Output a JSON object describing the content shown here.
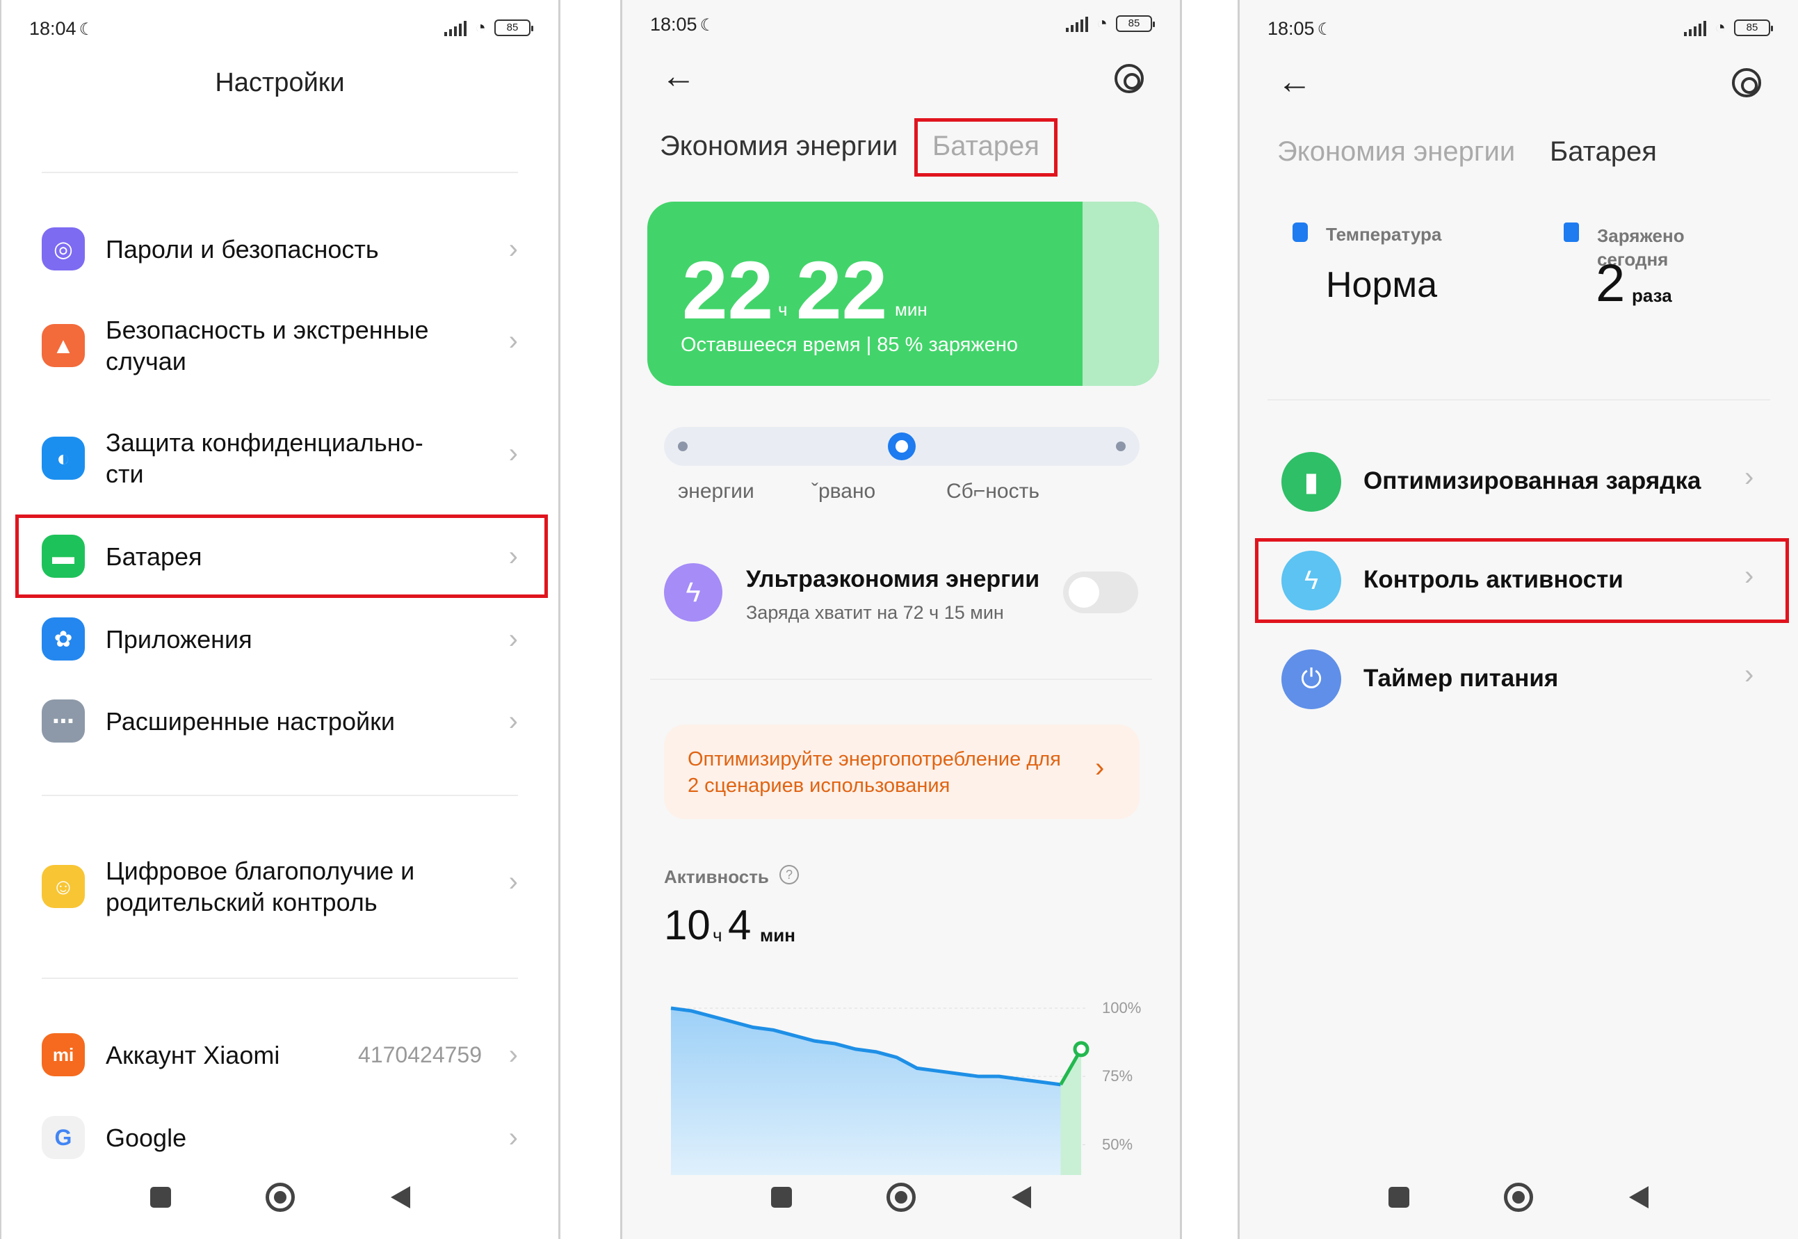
{
  "panel1": {
    "status": {
      "time": "18:04",
      "battery": "85"
    },
    "title": "Настройки",
    "items": [
      {
        "label": "Пароли и безопасность"
      },
      {
        "label": "Безопасность и экстренные\nслучаи"
      },
      {
        "label": "Защита конфиденциально-\nсти"
      },
      {
        "label": "Батарея"
      },
      {
        "label": "Приложения"
      },
      {
        "label": "Расширенные настройки"
      },
      {
        "label": "Цифровое благополучие и\nродительский контроль"
      },
      {
        "label": "Аккаунт Xiaomi",
        "value": "4170424759"
      },
      {
        "label": "Google"
      }
    ]
  },
  "panel2": {
    "status": {
      "time": "18:05",
      "battery": "85"
    },
    "tabs": [
      "Экономия энергии",
      "Батарея"
    ],
    "remaining": {
      "hours": "22",
      "h_unit": "ч",
      "minutes": "22",
      "m_unit": "мин",
      "caption": "Оставшееся время | 85 % заряжено"
    },
    "modes": [
      "энергии",
      "ˇрвано",
      "Сб⌐ность"
    ],
    "ultra": {
      "title": "Ультраэкономия энергии",
      "subtitle": "Заряда хватит на 72 ч 15 мин"
    },
    "tip": {
      "line1": "Оптимизируйте энергопотребление для",
      "line2": "2 сценариев использования"
    },
    "activity": {
      "label": "Активность",
      "hours": "10",
      "h_unit": "ч",
      "minutes": "4",
      "m_unit": "мин"
    },
    "chart_data": {
      "type": "area",
      "y_ticks": [
        "100%",
        "75%",
        "50%"
      ],
      "ylim": [
        45,
        100
      ],
      "values": [
        100,
        99,
        97,
        95,
        93,
        92,
        90,
        88,
        87,
        85,
        84,
        82,
        78,
        77,
        76,
        75,
        75,
        74,
        73,
        72,
        85
      ]
    }
  },
  "panel3": {
    "status": {
      "time": "18:05",
      "battery": "85"
    },
    "tabs": [
      "Экономия энергии",
      "Батарея"
    ],
    "temp": {
      "label": "Температура",
      "value": "Норма"
    },
    "charged": {
      "label": "Заряжено\nсегодня",
      "count": "2",
      "unit": "раза"
    },
    "items": [
      {
        "label": "Оптимизированная зарядка"
      },
      {
        "label": "Контроль активности"
      },
      {
        "label": "Таймер питания"
      }
    ]
  }
}
